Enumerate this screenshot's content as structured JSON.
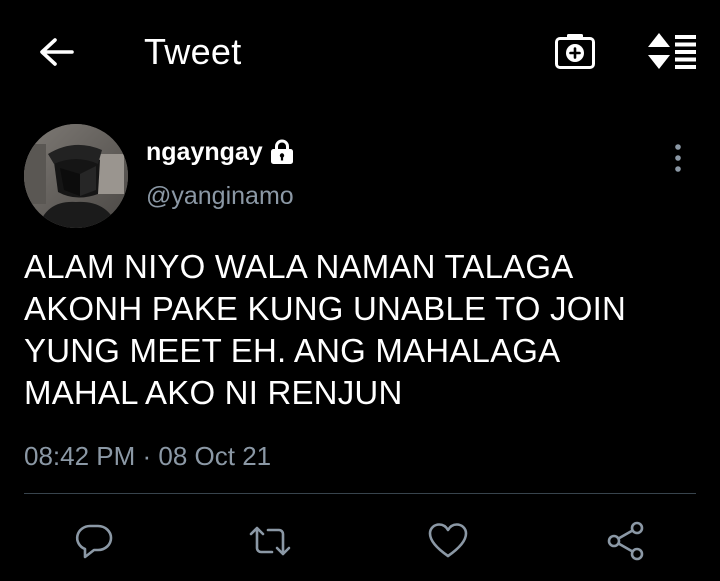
{
  "header": {
    "title": "Tweet",
    "back_icon": "arrow-left-icon",
    "camera_icon": "camera-plus-icon",
    "sort_icon": "sort-list-icon"
  },
  "author": {
    "display_name": "ngayngay",
    "handle": "@yanginamo",
    "protected_icon": "lock-icon",
    "avatar": "avatar-image"
  },
  "tweet": {
    "text": "ALAM NIYO WALA NAMAN TALAGA\nAKONH PAKE KUNG UNABLE TO JOIN\nYUNG MEET EH. ANG MAHALAGA\nMAHAL AKO NI RENJUN",
    "timestamp": "08:42 PM · 08 Oct 21"
  },
  "actions": {
    "reply_icon": "reply-icon",
    "retweet_icon": "retweet-icon",
    "like_icon": "heart-icon",
    "share_icon": "share-icon"
  },
  "colors": {
    "background": "#000000",
    "text": "#ffffff",
    "secondary_text": "#8b98a5",
    "divider": "#38444d",
    "icon": "#8b98a5"
  }
}
